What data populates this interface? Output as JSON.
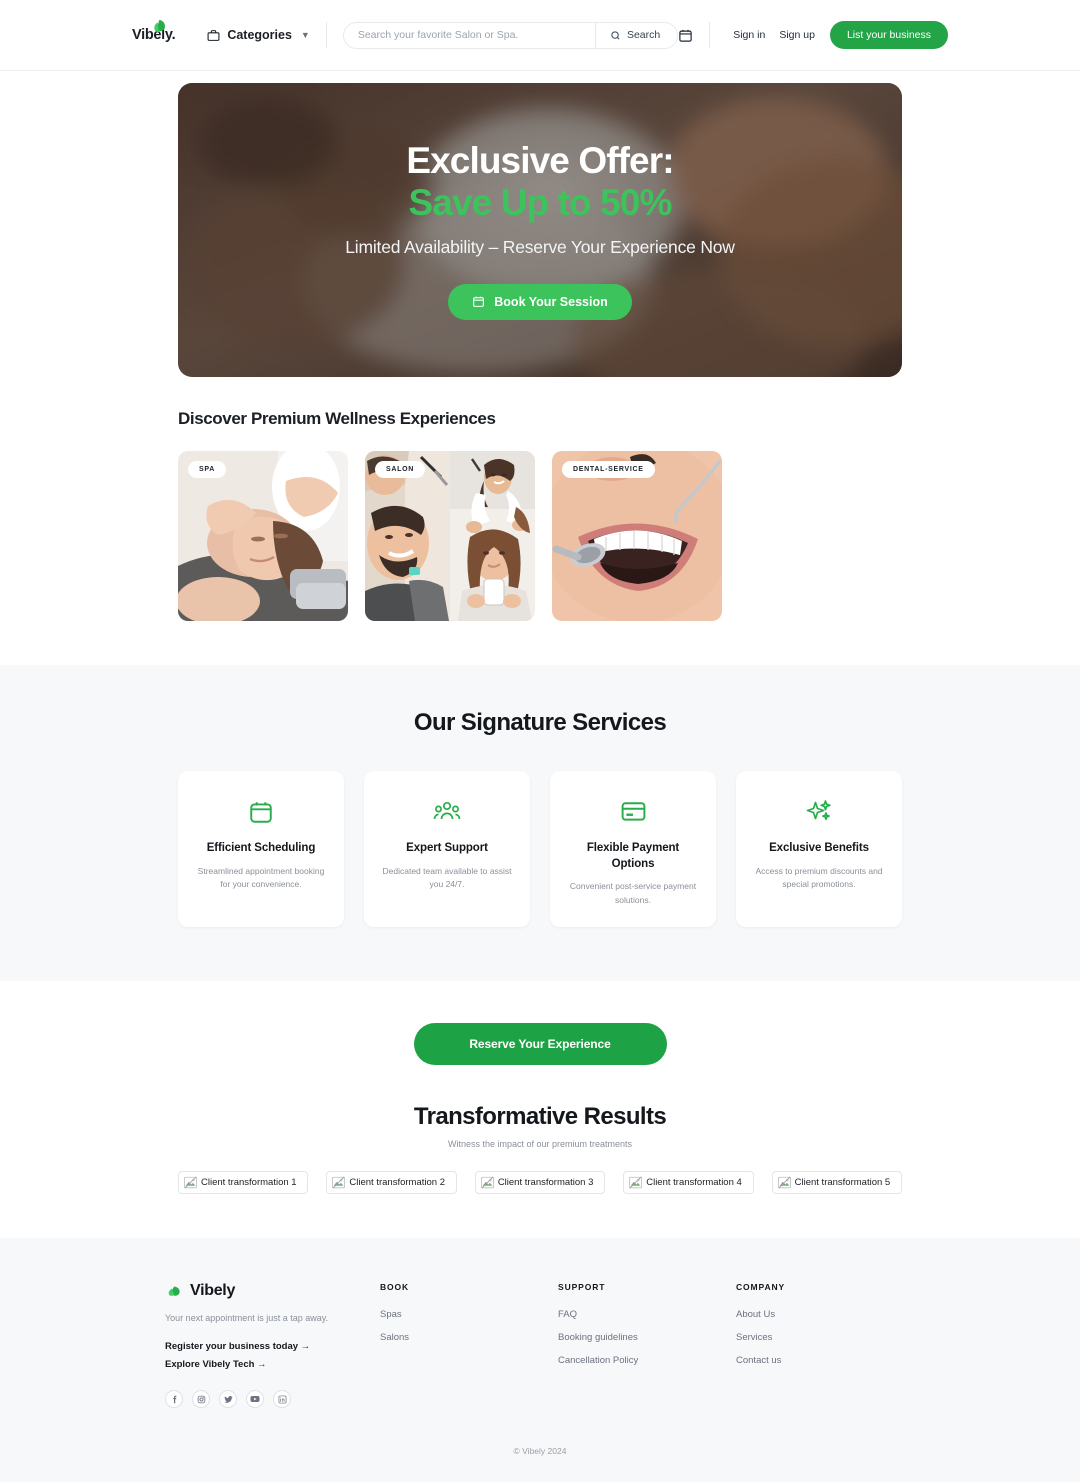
{
  "colors": {
    "brand_green": "#23a447",
    "hero_green": "#3cc35b",
    "cta_green": "#1da345",
    "band_bg": "#f7f8fa",
    "text_dark": "#14181d",
    "text_muted": "#8a9099"
  },
  "header": {
    "logo_text": "Vibely.",
    "logo_icon": "leaf-icon",
    "categories_label": "Categories",
    "categories_icon": "briefcase-icon",
    "chevron_icon": "chevron-down-icon",
    "search": {
      "placeholder": "Search your favorite Salon or Spa.",
      "value": "",
      "button_label": "Search",
      "button_icon": "search-icon"
    },
    "calendar_icon": "calendar-icon",
    "sign_in_label": "Sign in",
    "sign_up_label": "Sign up",
    "list_business_label": "List your business"
  },
  "hero": {
    "title_line1": "Exclusive Offer:",
    "title_line2": "Save Up to 50%",
    "subtitle": "Limited Availability – Reserve Your Experience Now",
    "button_label": "Book Your Session",
    "button_icon": "calendar-icon"
  },
  "discover": {
    "heading": "Discover Premium Wellness Experiences",
    "cards": [
      {
        "badge": "SPA",
        "alt": "Woman receiving facial massage at spa"
      },
      {
        "badge": "SALON",
        "alt": "Barber cutting man's hair and stylist styling woman's hair"
      },
      {
        "badge": "DENTAL-SERVICE",
        "alt": "Close-up of dental examination with mirror tool"
      }
    ]
  },
  "services": {
    "heading": "Our Signature Services",
    "cards": [
      {
        "icon": "calendar-icon",
        "title": "Efficient Scheduling",
        "desc": "Streamlined appointment booking for your convenience."
      },
      {
        "icon": "users-group-icon",
        "title": "Expert Support",
        "desc": "Dedicated team available to assist you 24/7."
      },
      {
        "icon": "credit-card-icon",
        "title": "Flexible Payment Options",
        "desc": "Convenient post-service payment solutions."
      },
      {
        "icon": "sparkles-icon",
        "title": "Exclusive Benefits",
        "desc": "Access to premium discounts and special promotions."
      }
    ]
  },
  "cta": {
    "button_label": "Reserve Your Experience"
  },
  "results": {
    "heading": "Transformative Results",
    "subheading": "Witness the impact of our premium treatments",
    "items": [
      {
        "alt": "Client transformation 1"
      },
      {
        "alt": "Client transformation 2"
      },
      {
        "alt": "Client transformation 3"
      },
      {
        "alt": "Client transformation 4"
      },
      {
        "alt": "Client transformation 5"
      }
    ]
  },
  "footer": {
    "brand_name": "Vibely",
    "brand_icon": "leaf-icon",
    "tagline": "Your next appointment is just a tap away.",
    "cta_links": [
      "Register your business today →",
      "Explore Vibely Tech →"
    ],
    "socials": [
      "facebook-icon",
      "instagram-icon",
      "twitter-icon",
      "youtube-icon",
      "linkedin-icon"
    ],
    "columns": [
      {
        "heading": "BOOK",
        "links": [
          "Spas",
          "Salons"
        ]
      },
      {
        "heading": "SUPPORT",
        "links": [
          "FAQ",
          "Booking guidelines",
          "Cancellation Policy"
        ]
      },
      {
        "heading": "COMPANY",
        "links": [
          "About Us",
          "Services",
          "Contact us"
        ]
      }
    ],
    "copyright": "© Vibely 2024"
  }
}
